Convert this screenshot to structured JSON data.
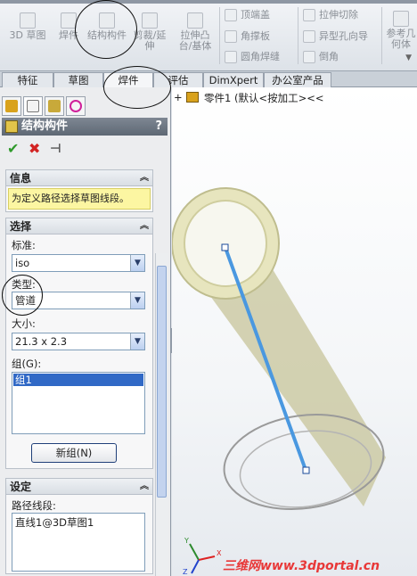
{
  "ribbon": {
    "big_buttons": [
      {
        "label": "3D 草图",
        "icon": "3d-sketch-icon"
      },
      {
        "label": "焊件",
        "icon": "weldment-icon"
      },
      {
        "label": "结构构件",
        "icon": "structural-member-icon"
      },
      {
        "label": "剪裁/延伸",
        "icon": "trim-extend-icon"
      },
      {
        "label": "拉伸凸台/基体",
        "icon": "extruded-boss-icon"
      }
    ],
    "small_col1": [
      {
        "label": "顶端盖",
        "icon": "end-cap-icon"
      },
      {
        "label": "角撑板",
        "icon": "gusset-icon"
      },
      {
        "label": "圆角焊缝",
        "icon": "fillet-bead-icon"
      }
    ],
    "small_col2": [
      {
        "label": "拉伸切除",
        "icon": "extruded-cut-icon"
      },
      {
        "label": "异型孔向导",
        "icon": "hole-wizard-icon"
      },
      {
        "label": "倒角",
        "icon": "chamfer-icon"
      }
    ],
    "ref_geometry": "参考几何体"
  },
  "tabs": [
    "特征",
    "草图",
    "焊件",
    "评估",
    "DimXpert",
    "办公室产品"
  ],
  "active_tab": "焊件",
  "property_manager": {
    "title": "结构构件",
    "help": "?",
    "ok": "✔",
    "cancel": "✖",
    "pin": "⊣"
  },
  "info_group": {
    "title": "信息",
    "message": "为定义路径选择草图线段。"
  },
  "selection_group": {
    "title": "选择",
    "standard_label": "标准:",
    "standard_value": "iso",
    "type_label": "类型:",
    "type_value": "管道",
    "size_label": "大小:",
    "size_value": "21.3 x 2.3",
    "groups_label": "组(G):",
    "groups": [
      "组1"
    ],
    "new_group_button": "新组(N)"
  },
  "settings_group": {
    "title": "设定",
    "path_label": "路径线段:",
    "path_items": [
      "直线1@3D草图1"
    ]
  },
  "tree": {
    "expander": "+",
    "root": "零件1  (默认<按加工><<"
  },
  "watermark": "三维网www.3dportal.cn",
  "triad": {
    "x": "X",
    "y": "Y",
    "z": "Z"
  },
  "colors": {
    "tube": "#d8d5a8",
    "path_line": "#4a98e0",
    "info_bg": "#fcf6a2",
    "selection": "#3169c6"
  }
}
